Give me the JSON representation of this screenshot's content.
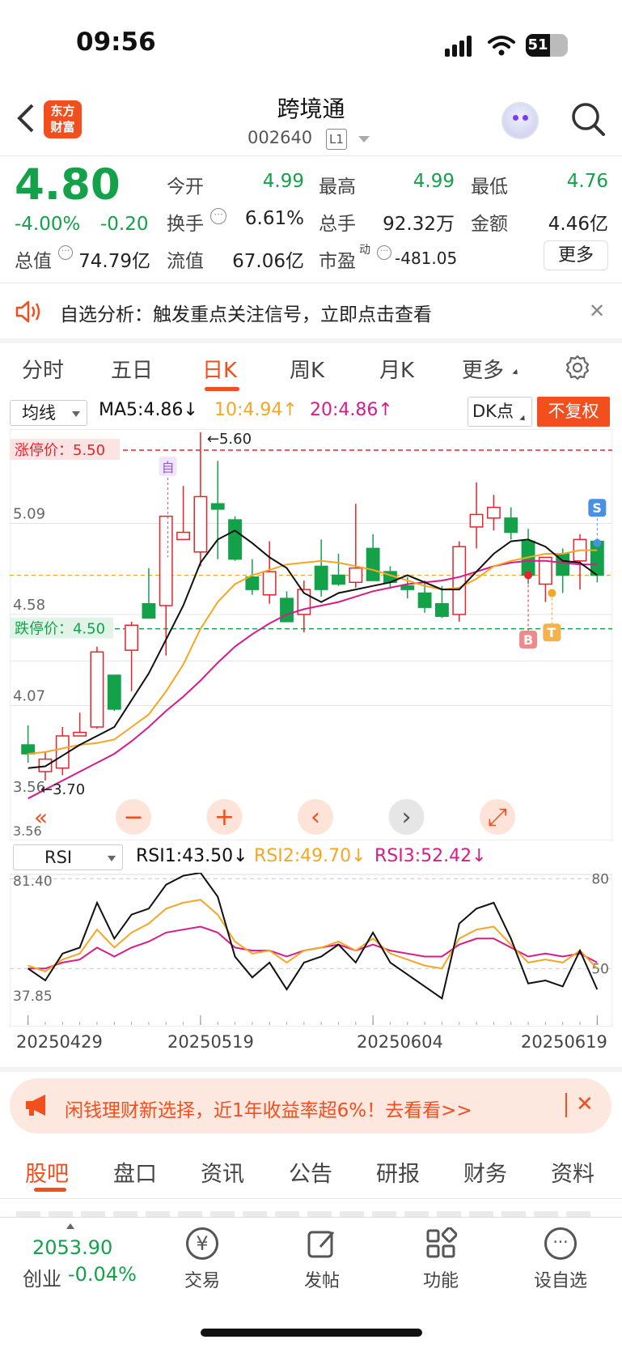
{
  "status": {
    "time": "09:56",
    "battery": "51"
  },
  "header": {
    "logo": "东方\n财富",
    "title": "跨境通",
    "code": "002640",
    "level": "L1"
  },
  "quote": {
    "price": "4.80",
    "change_pct": "-4.00%",
    "change": "-0.20",
    "open_label": "今开",
    "open": "4.99",
    "high_label": "最高",
    "high": "4.99",
    "low_label": "最低",
    "low": "4.76",
    "turnover_label": "换手",
    "turnover": "6.61%",
    "volume_label": "总手",
    "volume": "92.32万",
    "amount_label": "金额",
    "amount": "4.46亿",
    "mktcap_label": "总值",
    "mktcap": "74.79亿",
    "float_label": "流值",
    "float": "67.06亿",
    "pe_label": "市盈",
    "pe_sup": "动",
    "pe": "-481.05",
    "more": "更多"
  },
  "banner": {
    "text": "自选分析：触发重点关注信号，立即点击查看"
  },
  "tabs": {
    "items": [
      "分时",
      "五日",
      "日K",
      "周K",
      "月K",
      "更多"
    ],
    "active": "日K"
  },
  "toolbar": {
    "indicator": "均线",
    "ma5": "MA5:4.86",
    "ma10": "10:4.94",
    "ma20": "20:4.86",
    "dk": "DK点",
    "fq": "不复权"
  },
  "colors": {
    "up": "#e8232b",
    "down": "#13a24a",
    "ma5": "#111111",
    "ma10": "#f5a623",
    "ma20": "#d81b8a",
    "accent": "#f24e1e"
  },
  "chart_data": [
    {
      "type": "candlestick",
      "y_ticks": [
        "5.60",
        "5.09",
        "4.58",
        "4.07",
        "3.56"
      ],
      "limit_up_label": "涨停价：5.50",
      "limit_down_label": "跌停价：4.50",
      "max_label": "5.60",
      "min_label": "3.70",
      "markers": {
        "self": "自",
        "sell": "S",
        "buy": "B",
        "t": "T"
      },
      "candles": [
        [
          3.85,
          3.8,
          3.96,
          3.75
        ],
        [
          3.7,
          3.77,
          3.81,
          3.65
        ],
        [
          3.72,
          3.9,
          3.95,
          3.68
        ],
        [
          3.9,
          3.92,
          4.03,
          3.9
        ],
        [
          3.95,
          4.37,
          4.4,
          3.94
        ],
        [
          4.24,
          4.05,
          4.24,
          4.04
        ],
        [
          4.38,
          4.52,
          4.54,
          4.15
        ],
        [
          4.64,
          4.56,
          4.84,
          4.56
        ],
        [
          4.63,
          5.13,
          5.13,
          4.35
        ],
        [
          5.0,
          5.04,
          5.3,
          5.0
        ],
        [
          4.93,
          5.24,
          5.6,
          4.85
        ],
        [
          5.2,
          5.17,
          5.44,
          4.89
        ],
        [
          5.11,
          4.89,
          5.13,
          4.88
        ],
        [
          4.79,
          4.72,
          4.89,
          4.69
        ],
        [
          4.69,
          4.82,
          4.99,
          4.64
        ],
        [
          4.67,
          4.54,
          4.71,
          4.59
        ],
        [
          4.58,
          4.72,
          4.77,
          4.48
        ],
        [
          4.85,
          4.72,
          5.0,
          4.68
        ],
        [
          4.8,
          4.75,
          4.92,
          4.74
        ],
        [
          4.76,
          4.84,
          5.2,
          4.73
        ],
        [
          4.95,
          4.77,
          5.03,
          4.79
        ],
        [
          4.82,
          4.76,
          4.85,
          4.73
        ],
        [
          4.74,
          4.72,
          4.79,
          4.67
        ],
        [
          4.7,
          4.62,
          4.77,
          4.59
        ],
        [
          4.64,
          4.57,
          4.74,
          4.56
        ],
        [
          4.58,
          4.96,
          4.99,
          4.54
        ],
        [
          5.07,
          5.14,
          5.32,
          4.95
        ],
        [
          5.12,
          5.18,
          5.25,
          5.05
        ],
        [
          5.12,
          5.04,
          5.18,
          5.0
        ],
        [
          4.99,
          4.8,
          5.06,
          4.75
        ],
        [
          4.75,
          4.9,
          4.9,
          4.65
        ],
        [
          4.92,
          4.8,
          4.95,
          4.7
        ],
        [
          4.88,
          5.0,
          5.03,
          4.72
        ],
        [
          4.99,
          4.8,
          4.99,
          4.76
        ]
      ],
      "ma5": [
        3.72,
        3.73,
        3.79,
        3.85,
        3.9,
        3.95,
        4.1,
        4.25,
        4.44,
        4.63,
        4.87,
        5.0,
        5.05,
        4.98,
        4.9,
        4.84,
        4.7,
        4.65,
        4.7,
        4.72,
        4.74,
        4.76,
        4.8,
        4.76,
        4.72,
        4.72,
        4.82,
        4.92,
        4.99,
        5.0,
        4.96,
        4.88,
        4.87,
        4.8
      ],
      "ma10": [
        3.8,
        3.81,
        3.83,
        3.85,
        3.86,
        3.88,
        3.95,
        4.02,
        4.15,
        4.3,
        4.5,
        4.65,
        4.75,
        4.8,
        4.83,
        4.86,
        4.87,
        4.88,
        4.87,
        4.85,
        4.83,
        4.8,
        4.77,
        4.74,
        4.72,
        4.73,
        4.78,
        4.85,
        4.88,
        4.9,
        4.92,
        4.92,
        4.94,
        4.94
      ],
      "ma20": [
        3.55,
        3.6,
        3.65,
        3.7,
        3.75,
        3.8,
        3.87,
        3.95,
        4.04,
        4.12,
        4.21,
        4.31,
        4.4,
        4.47,
        4.53,
        4.58,
        4.61,
        4.63,
        4.65,
        4.68,
        4.71,
        4.73,
        4.75,
        4.76,
        4.77,
        4.79,
        4.82,
        4.85,
        4.87,
        4.88,
        4.88,
        4.87,
        4.86,
        4.86
      ]
    },
    {
      "type": "line",
      "indicator": "RSI",
      "rsi1": "RSI1:43.50",
      "rsi2": "RSI2:49.70",
      "rsi3": "RSI3:52.42",
      "y_left": [
        "81.40",
        "37.85"
      ],
      "y_right": [
        "80",
        "50"
      ],
      "dates": [
        "20250429",
        "20250519",
        "20250604",
        "20250619"
      ],
      "series": [
        {
          "name": "RSI1",
          "values": [
            50,
            46,
            55,
            57,
            72,
            60,
            68,
            70,
            78,
            81,
            82,
            74,
            54,
            47,
            52,
            43,
            52,
            54,
            58,
            52,
            62,
            52,
            48,
            44,
            40,
            65,
            70,
            72,
            60,
            45,
            46,
            44,
            56,
            43
          ]
        },
        {
          "name": "RSI2",
          "values": [
            51,
            49,
            53,
            55,
            63,
            57,
            62,
            65,
            70,
            72,
            73,
            68,
            59,
            55,
            56,
            52,
            56,
            57,
            59,
            56,
            60,
            55,
            53,
            51,
            50,
            60,
            63,
            64,
            58,
            52,
            53,
            52,
            56,
            50
          ]
        },
        {
          "name": "RSI3",
          "values": [
            50,
            50,
            52,
            53,
            57,
            54,
            57,
            59,
            62,
            63,
            64,
            62,
            57,
            56,
            56,
            54,
            56,
            57,
            58,
            56,
            58,
            56,
            55,
            54,
            54,
            58,
            60,
            60,
            57,
            54,
            55,
            54,
            55,
            52
          ]
        }
      ]
    }
  ],
  "ad": {
    "text": "闲钱理财新选择，近1年收益率超6%！去看看>>"
  },
  "bottom_tabs": {
    "items": [
      "股吧",
      "盘口",
      "资讯",
      "公告",
      "研报",
      "财务",
      "资料"
    ],
    "active": "股吧"
  },
  "footer": {
    "index_value": "2053.90",
    "index_name": "创业",
    "index_change": "-0.04%",
    "buttons": [
      "交易",
      "发帖",
      "功能",
      "设自选"
    ]
  }
}
